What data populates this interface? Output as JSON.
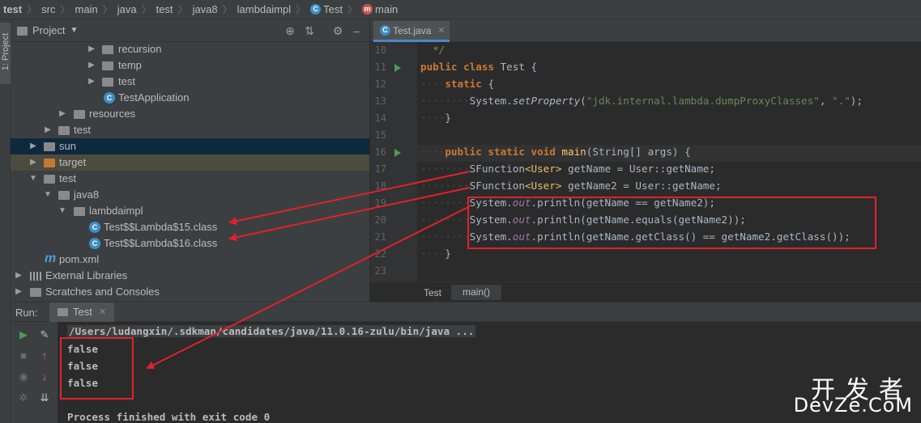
{
  "breadcrumb": [
    "test",
    "src",
    "main",
    "java",
    "test",
    "java8",
    "lambdaimpl",
    "Test",
    "main"
  ],
  "left_strip": {
    "project_tab": "1: Project"
  },
  "project_panel": {
    "title": "Project",
    "tree": [
      {
        "label": "recursion"
      },
      {
        "label": "temp"
      },
      {
        "label": "test"
      },
      {
        "label": "TestApplication"
      },
      {
        "label": "resources"
      },
      {
        "label": "test"
      },
      {
        "label": "sun"
      },
      {
        "label": "target"
      },
      {
        "label": "test"
      },
      {
        "label": "java8"
      },
      {
        "label": "lambdaimpl"
      },
      {
        "label": "Test$$Lambda$15.class"
      },
      {
        "label": "Test$$Lambda$16.class"
      },
      {
        "label": "pom.xml"
      },
      {
        "label": "External Libraries"
      },
      {
        "label": "Scratches and Consoles"
      }
    ]
  },
  "editor": {
    "tab": "Test.java",
    "line_numbers": [
      "10",
      "11",
      "12",
      "13",
      "14",
      "15",
      "16",
      "17",
      "18",
      "19",
      "20",
      "21",
      "22",
      "23"
    ],
    "code": {
      "l10": "*/",
      "l11_kw": "public class",
      "l11_name": "Test {",
      "l12_kw": "static",
      "l12_rest": "{",
      "l13_pre": "System.",
      "l13_fn": "setProperty",
      "l13_open": "(",
      "l13_s1": "\"jdk.internal.lambda.dumpProxyClasses\"",
      "l13_mid": ", ",
      "l13_s2": "\".\"",
      "l13_end": ");",
      "l14": "}",
      "l16_kw": "public static void",
      "l16_fn": "main",
      "l16_rest": "(String[] args) {",
      "l17_type": "SFunction",
      "l17_gen": "<User>",
      "l17_rest": " getName = User::getName;",
      "l18_type": "SFunction",
      "l18_gen": "<User>",
      "l18_rest": " getName2 = User::getName;",
      "l19_pre": "System.",
      "l19_out": "out",
      "l19_rest": ".println(getName == getName2);",
      "l20_pre": "System.",
      "l20_out": "out",
      "l20_rest": ".println(getName.equals(getName2));",
      "l21_pre": "System.",
      "l21_out": "out",
      "l21_rest": ".println(getName.getClass() == getName2.getClass());",
      "l22": "}"
    },
    "crumb": {
      "cls": "Test",
      "method": "main()"
    }
  },
  "run": {
    "label": "Run:",
    "tab": "Test",
    "command": "/Users/ludangxin/.sdkman/candidates/java/11.0.16-zulu/bin/java ...",
    "output": [
      "false",
      "false",
      "false"
    ],
    "finished": "Process finished with exit code 0"
  },
  "watermark": {
    "cn": "开发者",
    "en": "DevZe.CoM"
  },
  "colors": {
    "annotation": "#e0222a",
    "accent": "#4a88c7"
  }
}
